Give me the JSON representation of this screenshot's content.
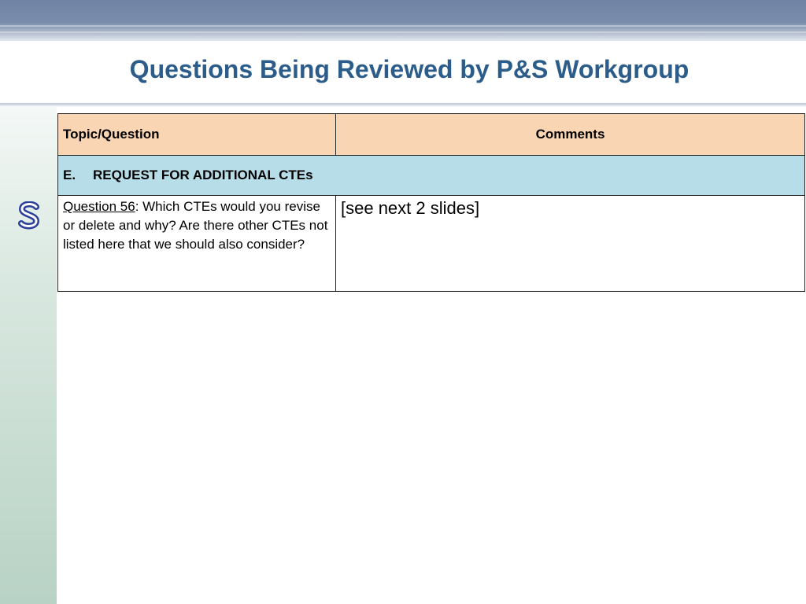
{
  "slide": {
    "title": "Questions Being Reviewed by P&S Workgroup",
    "logo_icon": "s-logo-icon",
    "colors": {
      "title": "#2c5d8a",
      "header_row": "#fad5b4",
      "section_row": "#b7dde8",
      "left_bar": "#b8d2c5",
      "top_band": "#6f82a3"
    }
  },
  "table": {
    "headers": [
      "Topic/Question",
      "Comments"
    ],
    "section": {
      "letter": "E.",
      "label": "REQUEST FOR ADDITIONAL CTEs"
    },
    "rows": [
      {
        "question_label": "Question 56",
        "question_text": ": Which CTEs would you revise or delete and why? Are there other CTEs not listed here that we should also consider?",
        "comment": "[see next 2 slides]"
      }
    ]
  }
}
